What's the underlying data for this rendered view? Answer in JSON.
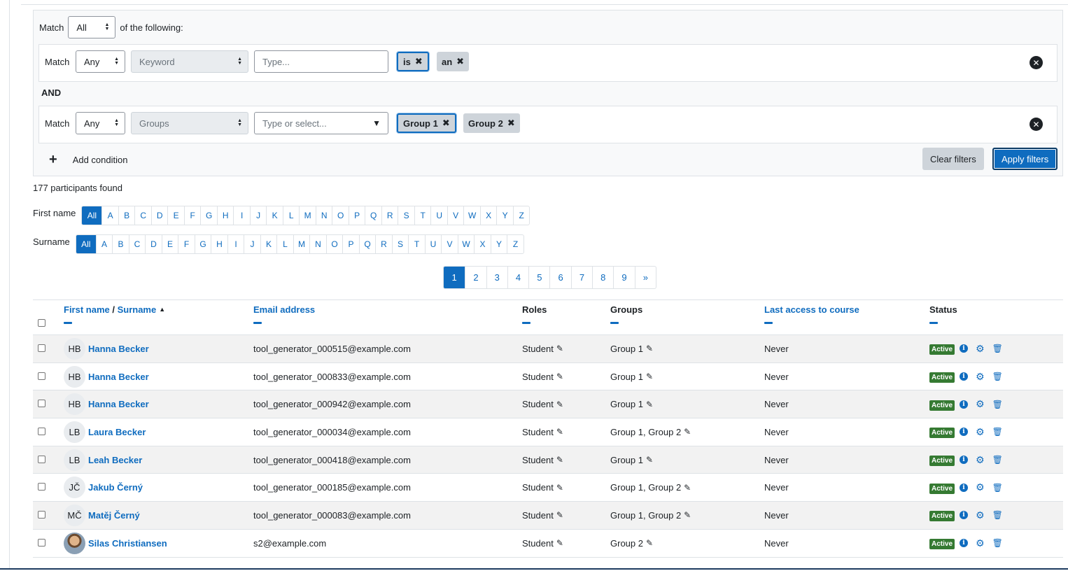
{
  "filters": {
    "match_label": "Match",
    "top_match_value": "All",
    "of_following": "of the following:",
    "and_label": "AND",
    "rows": [
      {
        "match_value": "Any",
        "type_value": "Keyword",
        "input_placeholder": "Type...",
        "chips": [
          "is",
          "an"
        ]
      },
      {
        "match_value": "Any",
        "type_value": "Groups",
        "input_placeholder": "Type or select...",
        "chips": [
          "Group 1",
          "Group 2"
        ]
      }
    ],
    "add_condition": "Add condition",
    "clear_filters": "Clear filters",
    "apply_filters": "Apply filters"
  },
  "participants_found": "177 participants found",
  "initials": {
    "first_name_label": "First name",
    "surname_label": "Surname",
    "all": "All",
    "letters": [
      "A",
      "B",
      "C",
      "D",
      "E",
      "F",
      "G",
      "H",
      "I",
      "J",
      "K",
      "L",
      "M",
      "N",
      "O",
      "P",
      "Q",
      "R",
      "S",
      "T",
      "U",
      "V",
      "W",
      "X",
      "Y",
      "Z"
    ]
  },
  "pagination": [
    "1",
    "2",
    "3",
    "4",
    "5",
    "6",
    "7",
    "8",
    "9",
    "»"
  ],
  "table": {
    "headers": {
      "first_name": "First name",
      "slash": " / ",
      "surname": "Surname",
      "email": "Email address",
      "roles": "Roles",
      "groups": "Groups",
      "last_access": "Last access to course",
      "status": "Status"
    },
    "rows": [
      {
        "initials": "HB",
        "name": "Hanna Becker",
        "email": "tool_generator_000515@example.com",
        "role": "Student",
        "groups": "Group 1",
        "last_access": "Never",
        "status": "Active"
      },
      {
        "initials": "HB",
        "name": "Hanna Becker",
        "email": "tool_generator_000833@example.com",
        "role": "Student",
        "groups": "Group 1",
        "last_access": "Never",
        "status": "Active"
      },
      {
        "initials": "HB",
        "name": "Hanna Becker",
        "email": "tool_generator_000942@example.com",
        "role": "Student",
        "groups": "Group 1",
        "last_access": "Never",
        "status": "Active"
      },
      {
        "initials": "LB",
        "name": "Laura Becker",
        "email": "tool_generator_000034@example.com",
        "role": "Student",
        "groups": "Group 1, Group 2",
        "last_access": "Never",
        "status": "Active"
      },
      {
        "initials": "LB",
        "name": "Leah Becker",
        "email": "tool_generator_000418@example.com",
        "role": "Student",
        "groups": "Group 1",
        "last_access": "Never",
        "status": "Active"
      },
      {
        "initials": "JČ",
        "name": "Jakub Černý",
        "email": "tool_generator_000185@example.com",
        "role": "Student",
        "groups": "Group 1, Group 2",
        "last_access": "Never",
        "status": "Active"
      },
      {
        "initials": "MČ",
        "name": "Matěj Černý",
        "email": "tool_generator_000083@example.com",
        "role": "Student",
        "groups": "Group 1, Group 2",
        "last_access": "Never",
        "status": "Active"
      },
      {
        "initials": "",
        "name": "Silas Christiansen",
        "email": "s2@example.com",
        "role": "Student",
        "groups": "Group 2",
        "last_access": "Never",
        "status": "Active"
      }
    ]
  },
  "colors": {
    "primary": "#0f6cbf",
    "active_badge": "#357a32"
  }
}
